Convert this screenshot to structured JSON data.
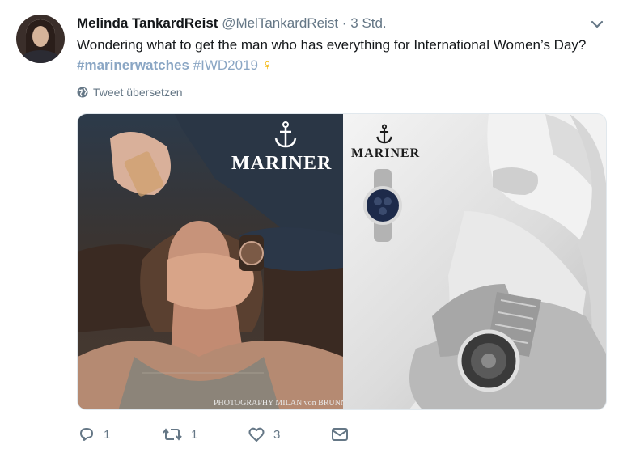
{
  "tweet": {
    "display_name": "Melinda TankardReist",
    "handle": "@MelTankardReist",
    "separator": "·",
    "time": "3 Std.",
    "text_plain": "Wondering what to get the man who has everything for International Women’s Day?",
    "hashtag1": "#marinerwatches",
    "hashtag2": "#IWD2019",
    "emoji": "♀",
    "translate_label": "Tweet übersetzen"
  },
  "media": {
    "left_brand": "MARINER",
    "right_brand": "MARINER",
    "credit": "PHOTOGRAPHY MILAN von BRUNN"
  },
  "actions": {
    "reply_count": "1",
    "retweet_count": "1",
    "like_count": "3"
  },
  "icons": {
    "reply": "reply-icon",
    "retweet": "retweet-icon",
    "like": "heart-icon",
    "dm": "envelope-icon",
    "menu": "chevron-down-icon",
    "translate": "globe-icon"
  },
  "colors": {
    "text": "#14171a",
    "muted": "#657786",
    "hashtag": "#8aa6c4",
    "emoji": "#f4b400"
  }
}
